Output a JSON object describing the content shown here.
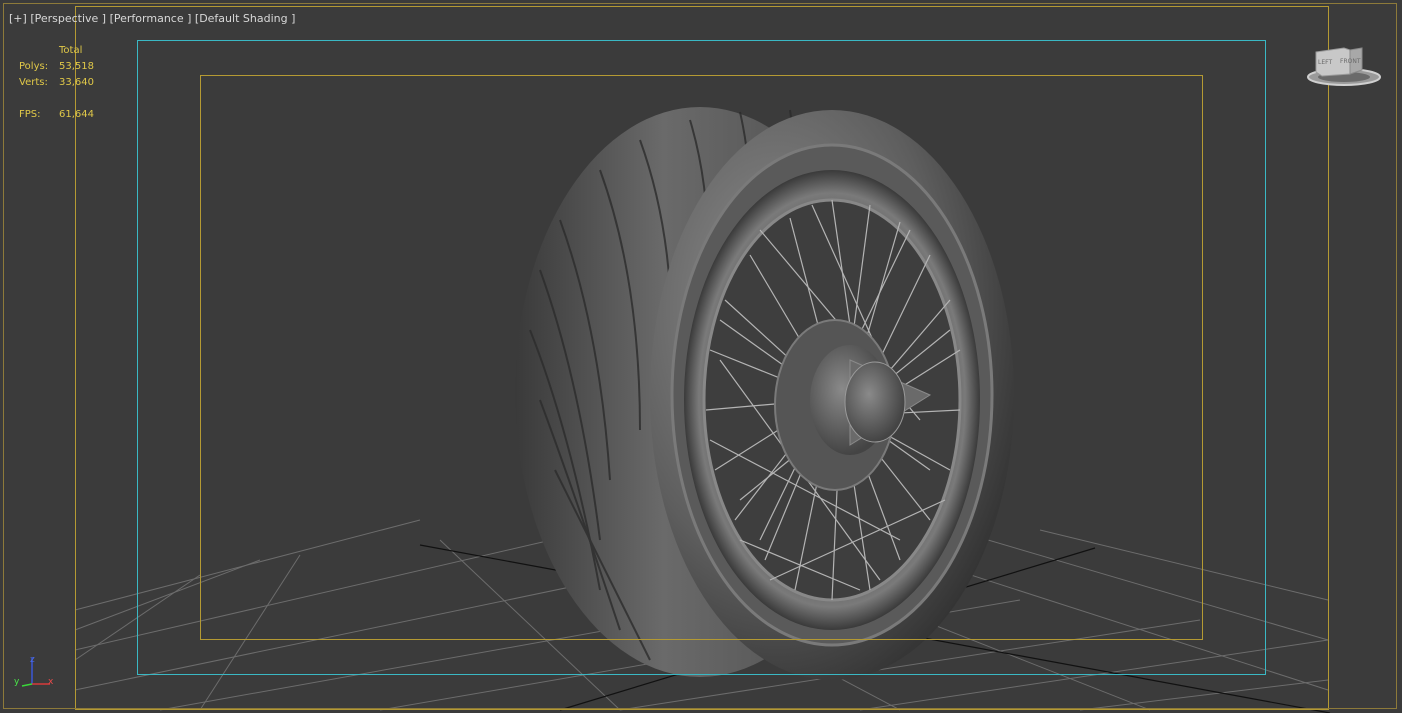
{
  "viewport": {
    "labels": {
      "plus": "[+]",
      "view": "[Perspective ]",
      "mode": "[Performance ]",
      "shading": "[Default Shading ]"
    },
    "stats": {
      "header": "Total",
      "polys_label": "Polys:",
      "polys_value": "53,518",
      "verts_label": "Verts:",
      "verts_value": "33,640",
      "fps_label": "FPS:",
      "fps_value": "61,644"
    },
    "viewcube": {
      "left": "LEFT",
      "front": "FRONT"
    },
    "axis": {
      "z": "z",
      "y": "y",
      "x": "x"
    }
  },
  "colors": {
    "background": "#3b3b3b",
    "stats_text": "#e0c848",
    "safe_frame": "#b49a33",
    "action_safe": "#3ab8c4",
    "grid": "#6c6c6c"
  }
}
